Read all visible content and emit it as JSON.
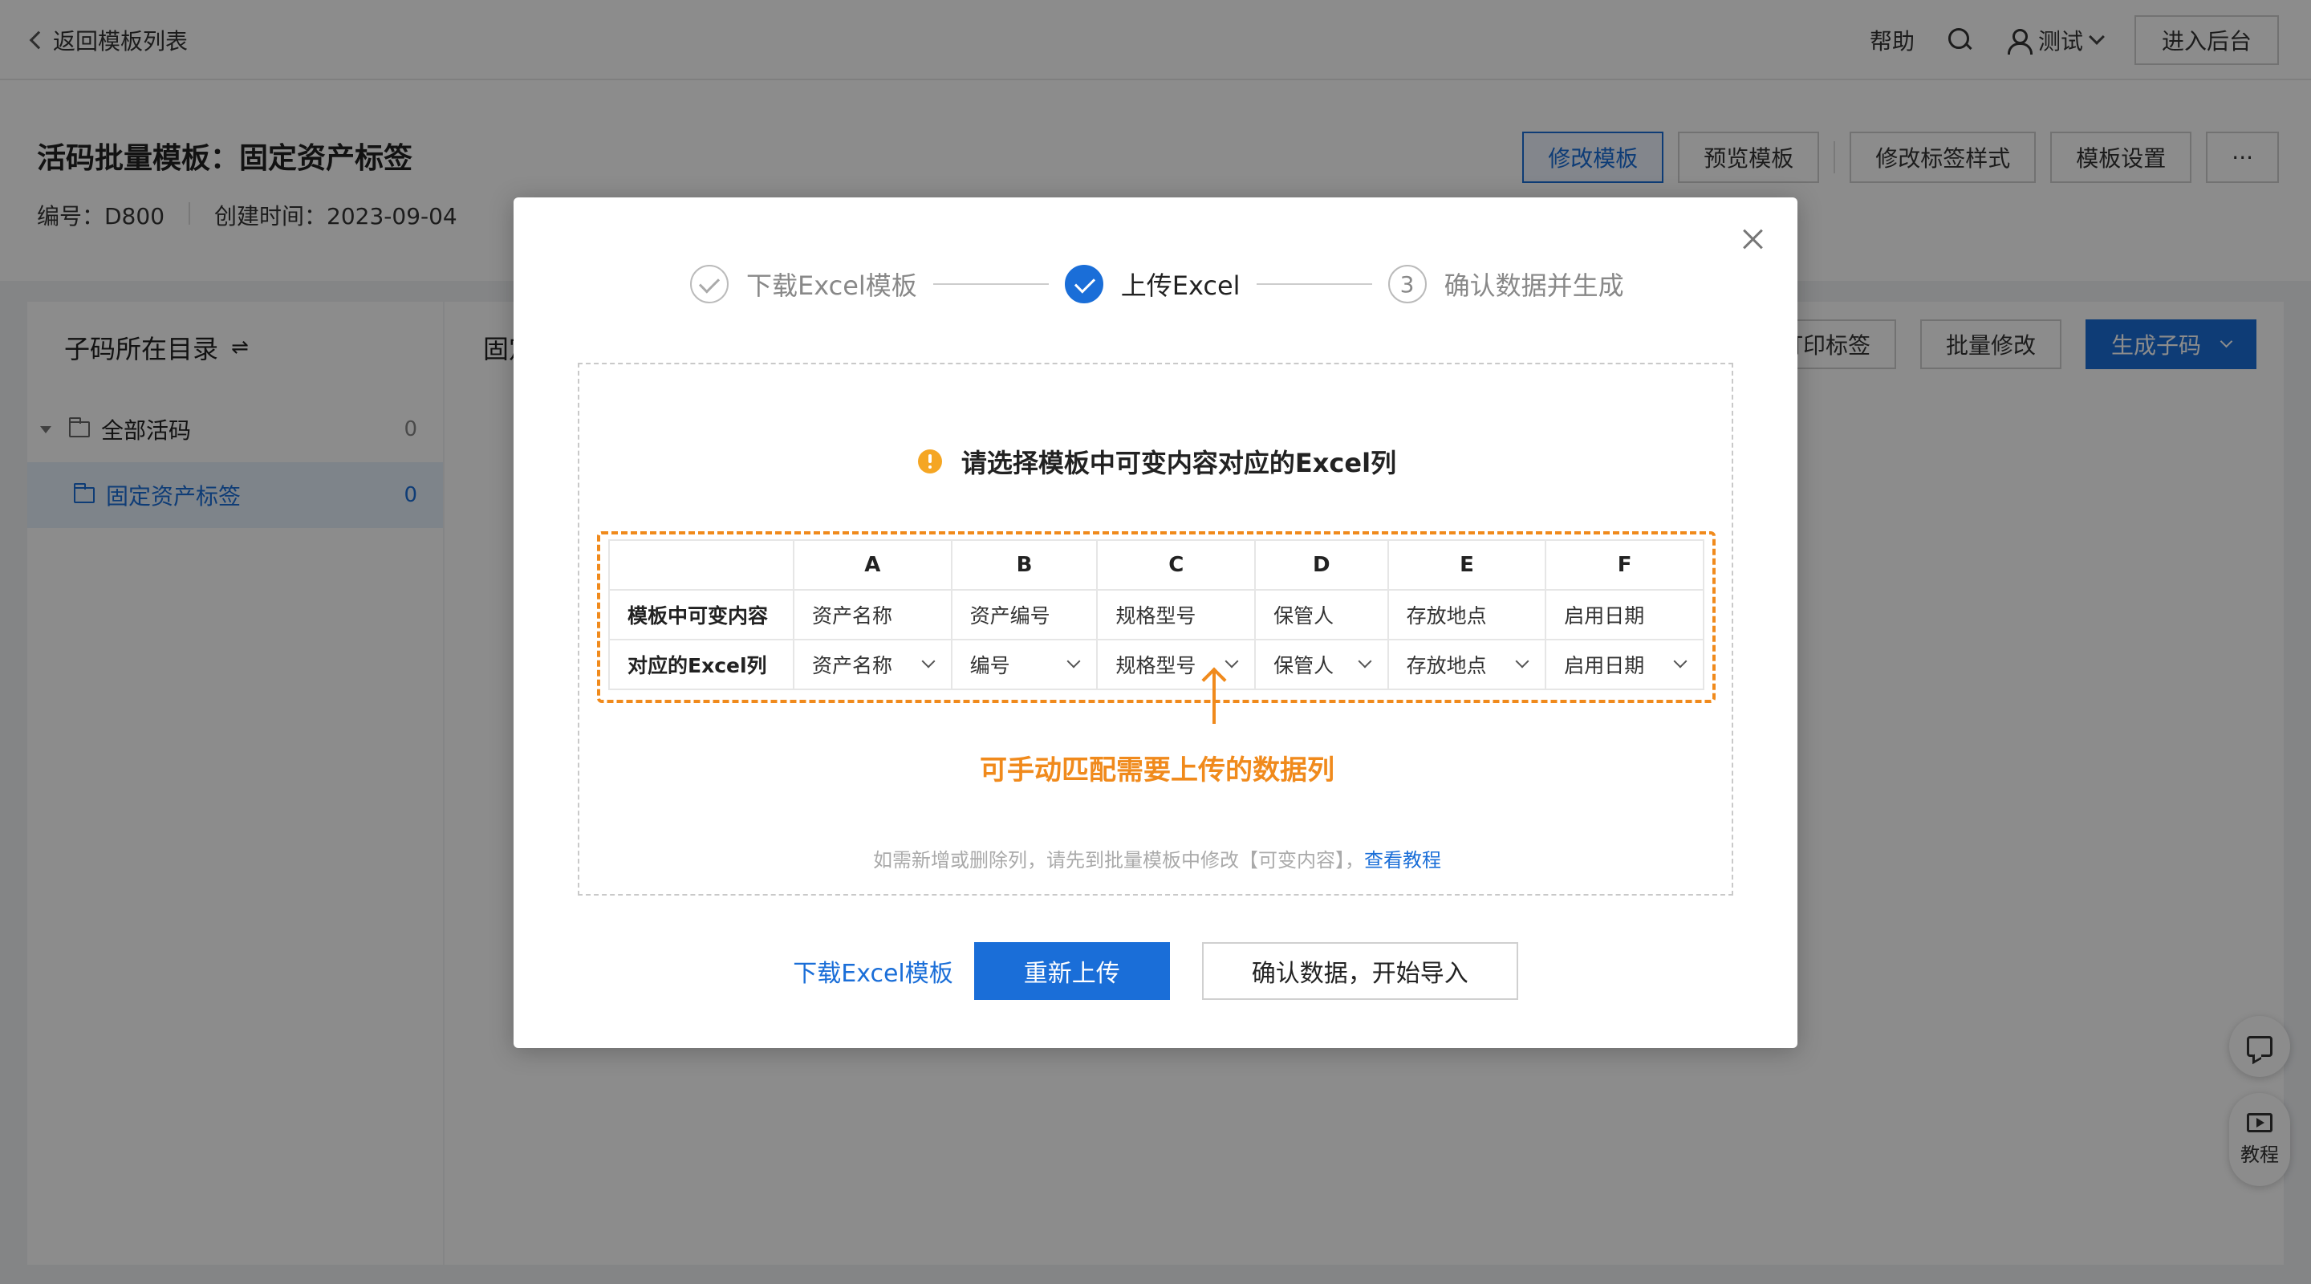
{
  "topbar": {
    "back_label": "返回模板列表",
    "help_label": "帮助",
    "user_name": "测试",
    "enter_admin_label": "进入后台"
  },
  "header": {
    "title": "活码批量模板：固定资产标签",
    "code_label": "编号：D800",
    "created_label": "创建时间：2023-09-04",
    "buttons": [
      "修改模板",
      "预览模板",
      "修改标签样式",
      "模板设置",
      "···"
    ]
  },
  "left_panel": {
    "title": "子码所在目录",
    "switch_icon": "⇌",
    "items": [
      {
        "label": "全部活码",
        "count": "0"
      },
      {
        "label": "固定资产标签",
        "count": "0"
      }
    ]
  },
  "right_panel": {
    "title_partial": "固定",
    "buttons": [
      "打印标签",
      "批量修改",
      "生成子码"
    ]
  },
  "float_buttons": {
    "tutorial_label": "教程"
  },
  "modal": {
    "steps": [
      {
        "label": "下载Excel模板",
        "state": "done"
      },
      {
        "label": "上传Excel",
        "state": "current"
      },
      {
        "label": "确认数据并生成",
        "state": "pending",
        "number": "3"
      }
    ],
    "hint_title": "请选择模板中可变内容对应的Excel列",
    "table": {
      "columns": [
        "A",
        "B",
        "C",
        "D",
        "E",
        "F"
      ],
      "row_labels": [
        "模板中可变内容",
        "对应的Excel列"
      ],
      "template_values": [
        "资产名称",
        "资产编号",
        "规格型号",
        "保管人",
        "存放地点",
        "启用日期"
      ],
      "excel_selections": [
        "资产名称",
        "编号",
        "规格型号",
        "保管人",
        "存放地点",
        "启用日期"
      ]
    },
    "annotation": "可手动匹配需要上传的数据列",
    "foot_note": "如需新增或删除列，请先到批量模板中修改【可变内容】，",
    "foot_link": "查看教程",
    "actions": {
      "download_label": "下载Excel模板",
      "reupload_label": "重新上传",
      "confirm_label": "确认数据，开始导入"
    }
  },
  "colors": {
    "primary": "#1a6ed8",
    "annotation_orange": "#f08a1c",
    "warning": "#f5a623"
  }
}
